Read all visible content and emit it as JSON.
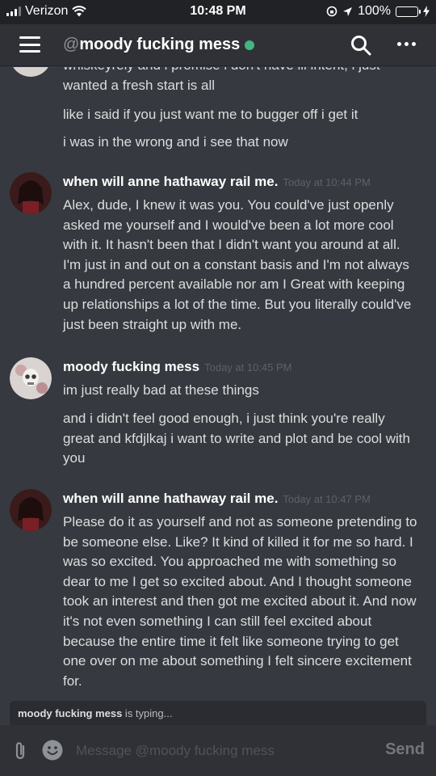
{
  "status_bar": {
    "carrier": "Verizon",
    "time": "10:48 PM",
    "battery": "100%"
  },
  "header": {
    "at": "@",
    "title": "moody fucking mess",
    "online_color": "#43b581"
  },
  "messages": {
    "continuation": {
      "lines": [
        "whiskeyrely and i promise i don't have ill intent, i just wanted a fresh start is all",
        "like i said if you just want me to bugger off i get it",
        "i was in the wrong and i see that now"
      ]
    },
    "groups": [
      {
        "author": "when will anne hathaway rail me.",
        "timestamp": "Today at 10:44 PM",
        "lines": [
          "Alex, dude, I knew it was you. You could've just openly asked me yourself and I would've been a lot more cool with it. It hasn't been that I didn't want you around at all. I'm just in and out on a constant basis and I'm not always a hundred percent available nor am I Great with keeping up relationships a lot of the time. But you literally could've just been straight up with me."
        ]
      },
      {
        "author": "moody fucking mess",
        "timestamp": "Today at 10:45 PM",
        "lines": [
          "im just really bad at these things",
          "and i didn't feel good enough, i just think you're really great and kfdjlkaj i want to write and plot and be cool with you"
        ]
      },
      {
        "author": "when will anne hathaway rail me.",
        "timestamp": "Today at 10:47 PM",
        "lines": [
          "Please do it as yourself and not as someone pretending to be someone else. Like? It kind of killed it for me so hard. I was so excited. You approached me with something so dear to me I get so excited about. And I thought someone took an interest and then got me excited about it. And now it's not even something I can still feel excited about because the entire time it felt like someone trying to get one over on me about something I felt sincere excitement for."
        ]
      }
    ]
  },
  "typing": {
    "user": "moody fucking mess",
    "suffix": " is typing..."
  },
  "composer": {
    "placeholder": "Message @moody fucking mess",
    "send_label": "Send"
  }
}
